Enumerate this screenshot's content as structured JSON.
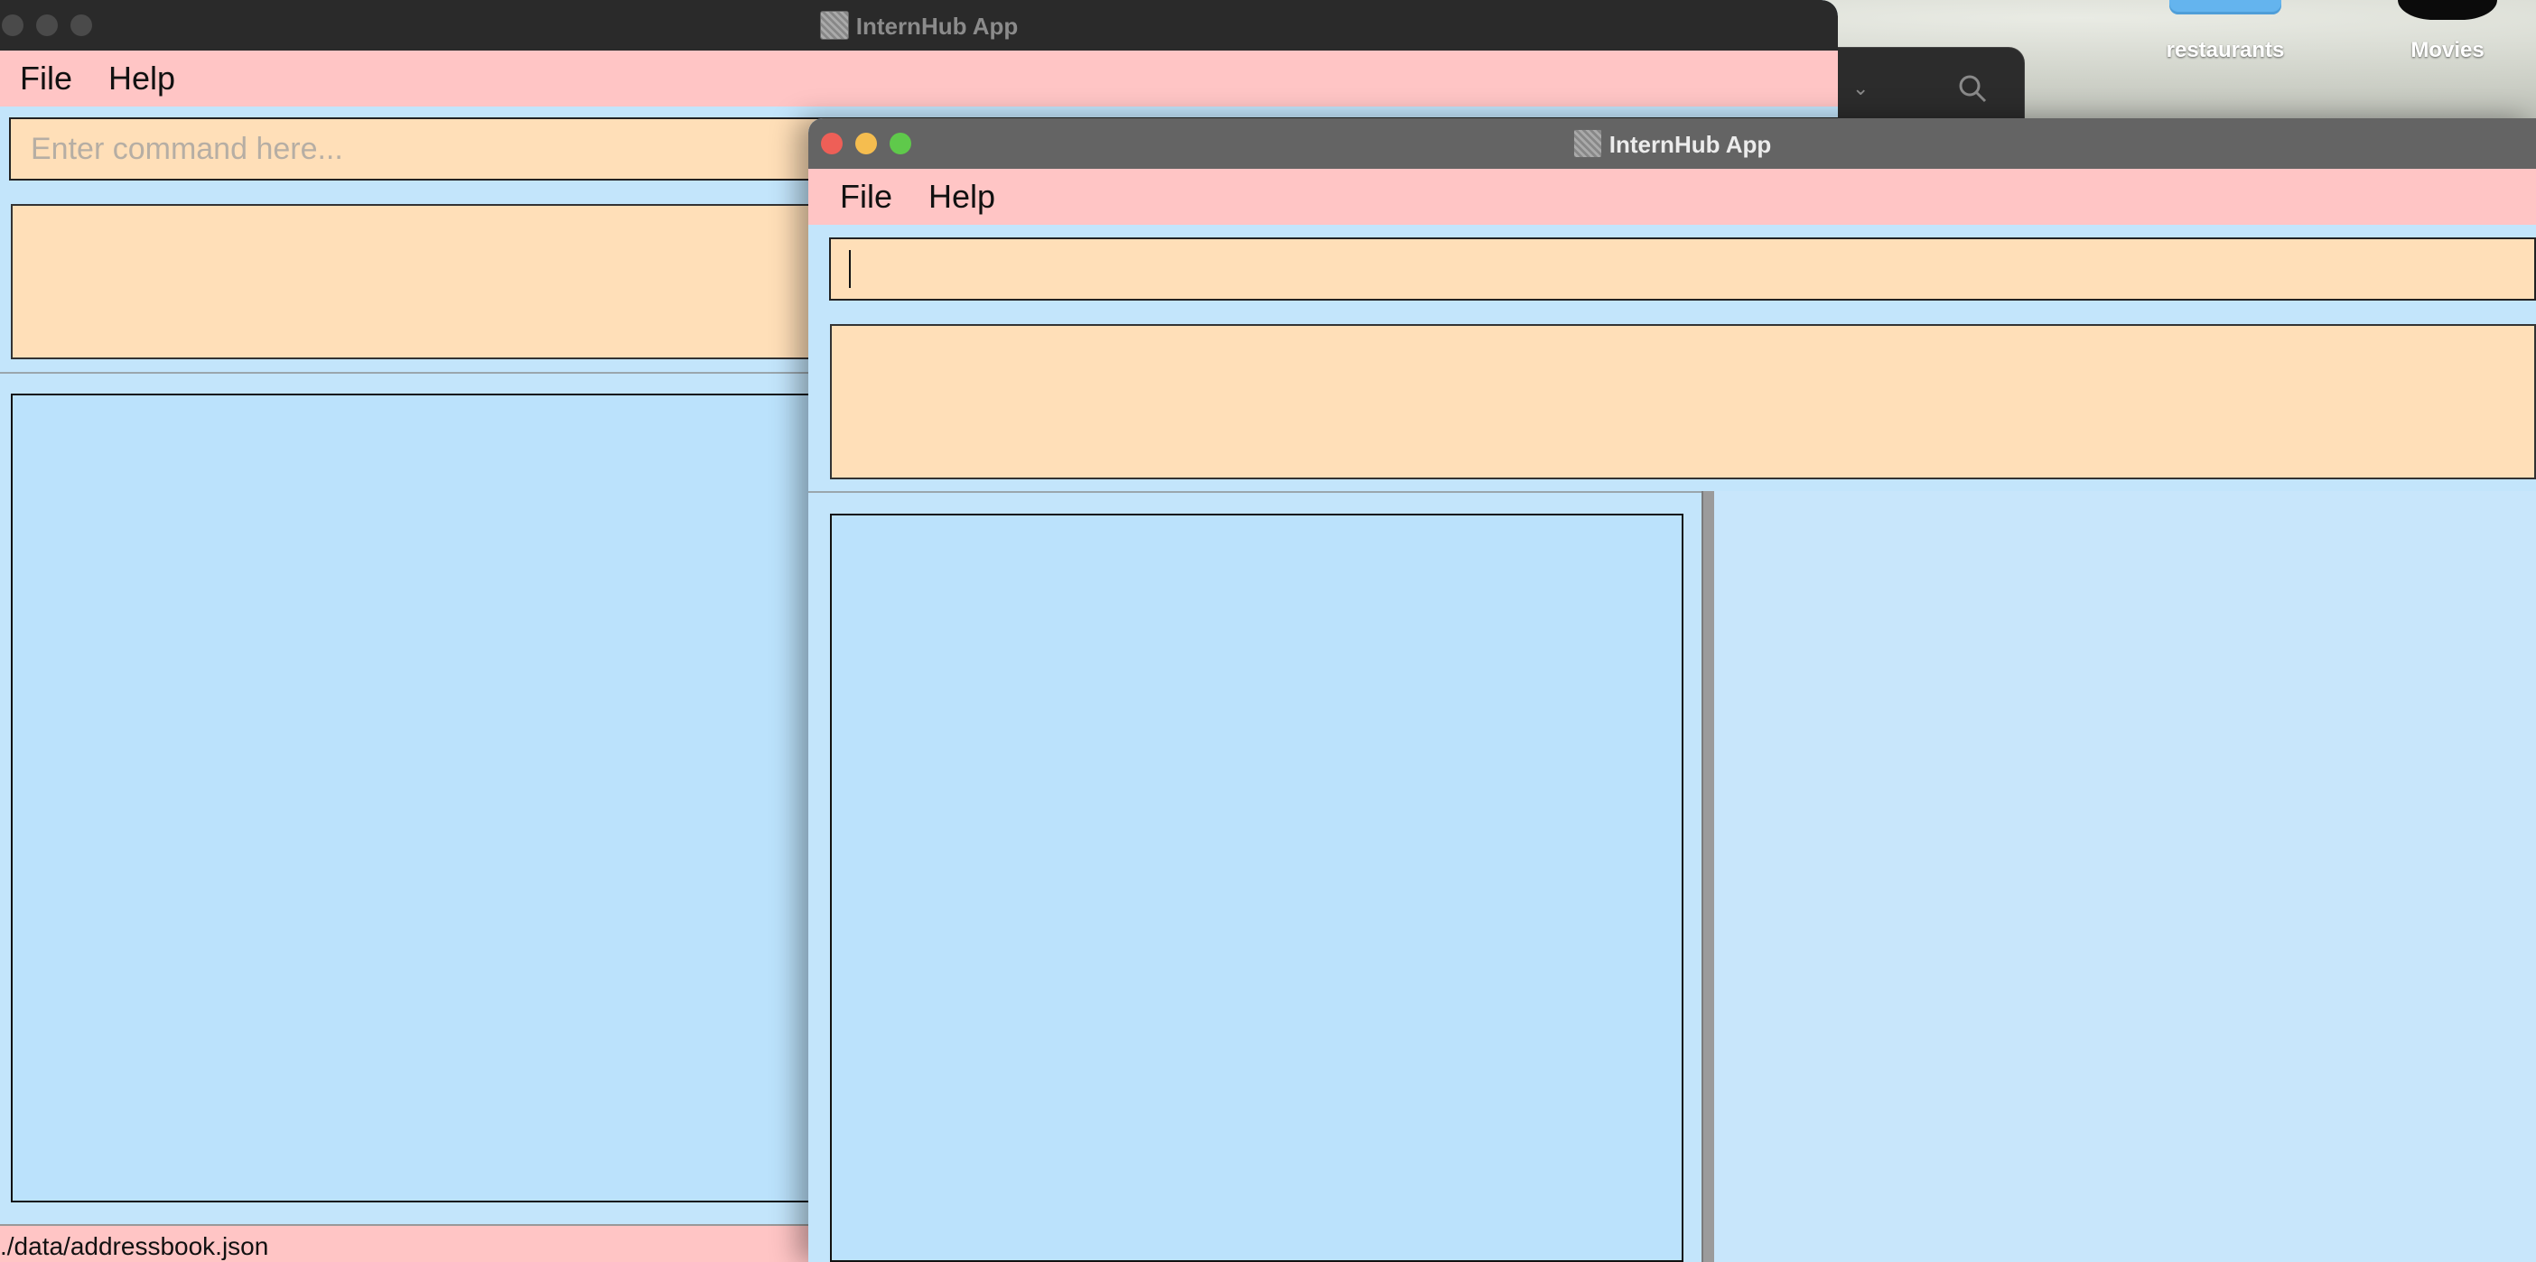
{
  "desktop": {
    "items": [
      {
        "label": "restaurants",
        "icon": "folder-icon"
      },
      {
        "label": "Movies",
        "icon": "movies-icon"
      }
    ]
  },
  "back_window": {
    "title": "InternHub App",
    "menu": [
      "File",
      "Help"
    ],
    "command_placeholder": "Enter command here...",
    "status_path": "./data/addressbook.json",
    "focused": false
  },
  "front_window": {
    "title": "InternHub App",
    "menu": [
      "File",
      "Help"
    ],
    "command_value": "",
    "focused": true
  },
  "colors": {
    "menu_bg": "#ffc5c5",
    "command_bg": "#ffdfb8",
    "panel_bg": "#bbe2fc",
    "close": "#ee5f57",
    "minimize": "#f5bd4f",
    "maximize": "#5fc94b"
  }
}
